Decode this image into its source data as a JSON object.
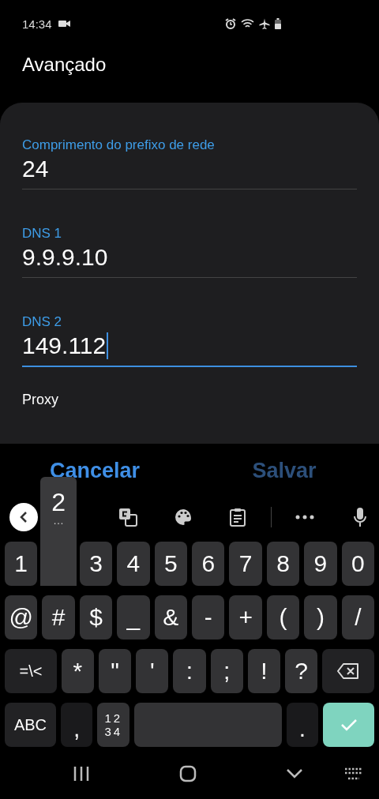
{
  "status_bar": {
    "time": "14:34"
  },
  "title": "Avançado",
  "fields": [
    {
      "label": "Comprimento do prefixo de rede",
      "value": "24",
      "focused": false
    },
    {
      "label": "DNS 1",
      "value": "9.9.9.10",
      "focused": false
    },
    {
      "label": "DNS 2",
      "value": "149.112",
      "focused": true
    }
  ],
  "proxy_label": "Proxy",
  "buttons": [
    {
      "label": "Cancelar",
      "disabled": false
    },
    {
      "label": "Salvar",
      "disabled": true
    }
  ],
  "keyboard": {
    "rows": [
      [
        {
          "kind": "char",
          "label": "1"
        },
        {
          "kind": "preview",
          "label": "2",
          "hint": "…"
        },
        {
          "kind": "char",
          "label": "3"
        },
        {
          "kind": "char",
          "label": "4"
        },
        {
          "kind": "char",
          "label": "5"
        },
        {
          "kind": "char",
          "label": "6"
        },
        {
          "kind": "char",
          "label": "7"
        },
        {
          "kind": "char",
          "label": "8"
        },
        {
          "kind": "char",
          "label": "9"
        },
        {
          "kind": "char",
          "label": "0"
        }
      ],
      [
        {
          "kind": "char",
          "label": "@"
        },
        {
          "kind": "char",
          "label": "#"
        },
        {
          "kind": "char",
          "label": "$"
        },
        {
          "kind": "char",
          "label": "_"
        },
        {
          "kind": "char",
          "label": "&"
        },
        {
          "kind": "char",
          "label": "-"
        },
        {
          "kind": "char",
          "label": "+"
        },
        {
          "kind": "char",
          "label": "("
        },
        {
          "kind": "char",
          "label": ")"
        },
        {
          "kind": "char",
          "label": "/"
        }
      ],
      [
        {
          "kind": "wide",
          "label": "=\\<"
        },
        {
          "kind": "char",
          "label": "*"
        },
        {
          "kind": "char",
          "label": "\""
        },
        {
          "kind": "char",
          "label": "'"
        },
        {
          "kind": "char",
          "label": ":"
        },
        {
          "kind": "char",
          "label": ";"
        },
        {
          "kind": "char",
          "label": "!"
        },
        {
          "kind": "char",
          "label": "?"
        },
        {
          "kind": "backspace"
        }
      ],
      [
        {
          "kind": "wide",
          "label": "ABC"
        },
        {
          "kind": "dark",
          "label": ","
        },
        {
          "kind": "numpad",
          "label": "12",
          "label2": "34"
        },
        {
          "kind": "space"
        },
        {
          "kind": "dark",
          "label": "."
        },
        {
          "kind": "enter"
        }
      ]
    ]
  }
}
